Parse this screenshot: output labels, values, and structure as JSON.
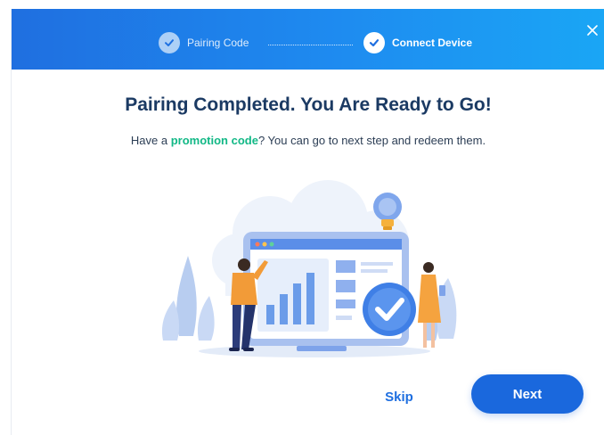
{
  "stepper": {
    "steps": [
      {
        "label": "Pairing Code",
        "state": "completed"
      },
      {
        "label": "Connect Device",
        "state": "active"
      }
    ]
  },
  "main": {
    "title": "Pairing Completed. You Are Ready to Go!",
    "subtitle_prefix": "Have a ",
    "subtitle_link": "promotion code",
    "subtitle_suffix": "? You can go to next step and redeem them."
  },
  "actions": {
    "skip_label": "Skip",
    "next_label": "Next"
  },
  "colors": {
    "header_start": "#1f6fe0",
    "header_end": "#1aa6f5",
    "accent_blue": "#1a68dd",
    "promo_green": "#12b886",
    "title_navy": "#1b3a63"
  },
  "icons": {
    "close": "close-icon",
    "step_check": "check-icon",
    "illustration_check": "check-circle-icon"
  }
}
